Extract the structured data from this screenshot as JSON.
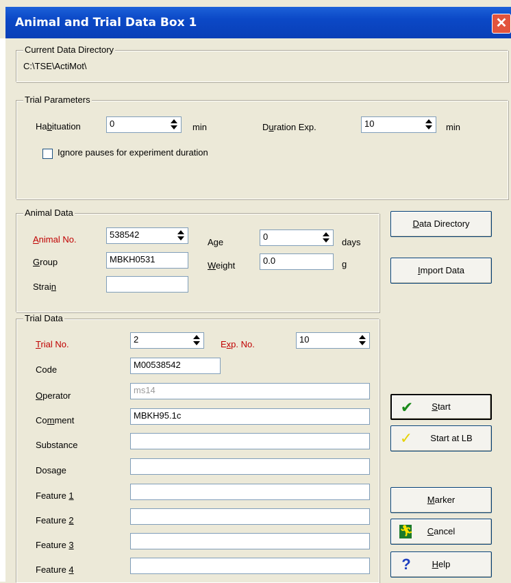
{
  "window": {
    "title": "Animal and Trial Data Box 1",
    "close_glyph": "✕"
  },
  "current_dir": {
    "legend": "Current Data Directory",
    "path": "C:\\TSE\\ActiMot\\"
  },
  "trial_params": {
    "legend": "Trial Parameters",
    "habituation_label": "Habituation",
    "habituation_value": "0",
    "habituation_unit": "min",
    "duration_label": "Duration Exp.",
    "duration_value": "10",
    "duration_unit": "min",
    "ignore_pauses_label": "Ignore pauses for experiment duration",
    "ignore_pauses_checked": false
  },
  "animal_data": {
    "legend": "Animal Data",
    "animal_no_label": "Animal No.",
    "animal_no_value": "538542",
    "group_label": "Group",
    "group_value": "MBKH0531",
    "strain_label": "Strain",
    "strain_value": "",
    "age_label": "Age",
    "age_value": "0",
    "age_unit": "days",
    "weight_label": "Weight",
    "weight_value": "0.0",
    "weight_unit": "g"
  },
  "trial_data": {
    "legend": "Trial Data",
    "trial_no_label": "Trial No.",
    "trial_no_value": "2",
    "exp_no_label": "Exp. No.",
    "exp_no_value": "10",
    "code_label": "Code",
    "code_value": "M00538542",
    "operator_label": "Operator",
    "operator_value": "ms14",
    "comment_label": "Comment",
    "comment_value": "MBKH95.1c",
    "substance_label": "Substance",
    "substance_value": "",
    "dosage_label": "Dosage",
    "dosage_value": "",
    "feature1_label": "Feature 1",
    "feature1_value": "",
    "feature2_label": "Feature 2",
    "feature2_value": "",
    "feature3_label": "Feature 3",
    "feature3_value": "",
    "feature4_label": "Feature 4",
    "feature4_value": ""
  },
  "buttons": {
    "data_directory": "Data Directory",
    "import_data": "Import Data",
    "start": "Start",
    "start_at_lb": "Start at LB",
    "marker": "Marker",
    "cancel": "Cancel",
    "help": "Help"
  },
  "icons": {
    "start": "checkmark-green-icon",
    "start_at_lb": "checkmark-yellow-icon",
    "cancel": "running-man-exit-icon",
    "help": "question-mark-icon"
  },
  "colors": {
    "title_bar": "#0a48c6",
    "required_label": "#c00000",
    "dialog_bg": "#ece9d8",
    "close_button": "#e2543d"
  }
}
